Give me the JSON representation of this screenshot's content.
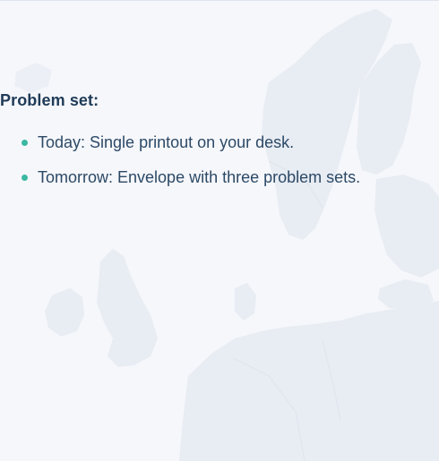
{
  "section": {
    "title": "Problem set:"
  },
  "bullets": [
    {
      "text": "Today: Single printout on your desk."
    },
    {
      "text": "Tomorrow: Envelope with three problem sets."
    }
  ],
  "colors": {
    "background": "#f6f7fb",
    "map": "#e8ecf3",
    "title": "#1f3b57",
    "text": "#2c4966",
    "bullet": "#3ab8a2"
  }
}
